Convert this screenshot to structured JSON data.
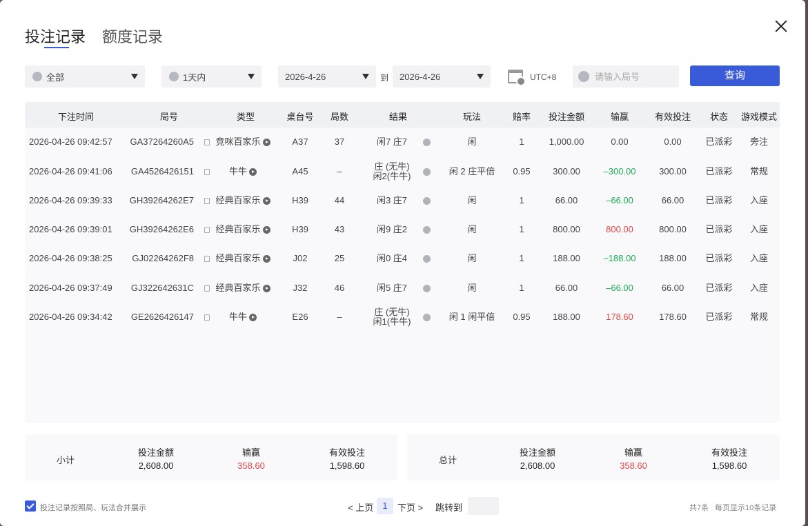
{
  "tabs": [
    {
      "label": "投注记录",
      "active": true
    },
    {
      "label": "额度记录",
      "active": false
    }
  ],
  "filters": {
    "game": "全部",
    "period": "1天内",
    "date_from": "2026-4-26",
    "to_label": "到",
    "date_to": "2026-4-26",
    "timezone": "UTC+8",
    "round_placeholder": "请输入局号",
    "query_label": "查询"
  },
  "table": {
    "headers": [
      "下注时间",
      "局号",
      "类型",
      "桌台号",
      "局数",
      "结果",
      "玩法",
      "赔率",
      "投注金额",
      "输赢",
      "有效投注",
      "状态",
      "游戏模式"
    ],
    "rows": [
      {
        "time": "2026-04-26 09:42:57",
        "round": "GA37264260A5",
        "type": "竞咪百家乐",
        "table": "A37",
        "count": "37",
        "result1": "闲7 庄7",
        "result2": "",
        "play": "闲",
        "odds": "1",
        "bet": "1,000.00",
        "win": "0.00",
        "win_sign": "zero",
        "valid": "0.00",
        "status": "已派彩",
        "mode": "旁注"
      },
      {
        "time": "2026-04-26 09:41:06",
        "round": "GA4526426151",
        "type": "牛牛",
        "table": "A45",
        "count": "–",
        "result1": "庄 (无牛)",
        "result2": "闲2(牛牛)",
        "play": "闲 2 庄平倍",
        "odds": "0.95",
        "bet": "300.00",
        "win": "–300.00",
        "win_sign": "neg",
        "valid": "300.00",
        "status": "已派彩",
        "mode": "常规"
      },
      {
        "time": "2026-04-26 09:39:33",
        "round": "GH39264262E7",
        "type": "经典百家乐",
        "table": "H39",
        "count": "44",
        "result1": "闲3 庄7",
        "result2": "",
        "play": "闲",
        "odds": "1",
        "bet": "66.00",
        "win": "–66.00",
        "win_sign": "neg",
        "valid": "66.00",
        "status": "已派彩",
        "mode": "入座"
      },
      {
        "time": "2026-04-26 09:39:01",
        "round": "GH39264262E6",
        "type": "经典百家乐",
        "table": "H39",
        "count": "43",
        "result1": "闲9 庄2",
        "result2": "",
        "play": "闲",
        "odds": "1",
        "bet": "800.00",
        "win": "800.00",
        "win_sign": "pos",
        "valid": "800.00",
        "status": "已派彩",
        "mode": "入座"
      },
      {
        "time": "2026-04-26 09:38:25",
        "round": "GJ02264262F8",
        "type": "经典百家乐",
        "table": "J02",
        "count": "25",
        "result1": "闲0 庄4",
        "result2": "",
        "play": "闲",
        "odds": "1",
        "bet": "188.00",
        "win": "–188.00",
        "win_sign": "neg",
        "valid": "188.00",
        "status": "已派彩",
        "mode": "入座"
      },
      {
        "time": "2026-04-26 09:37:49",
        "round": "GJ322642631C",
        "type": "经典百家乐",
        "table": "J32",
        "count": "46",
        "result1": "闲5 庄7",
        "result2": "",
        "play": "闲",
        "odds": "1",
        "bet": "66.00",
        "win": "–66.00",
        "win_sign": "neg",
        "valid": "66.00",
        "status": "已派彩",
        "mode": "入座"
      },
      {
        "time": "2026-04-26 09:34:42",
        "round": "GE2626426147",
        "type": "牛牛",
        "table": "E26",
        "count": "–",
        "result1": "庄 (无牛)",
        "result2": "闲1(牛牛)",
        "play": "闲 1 闲平倍",
        "odds": "0.95",
        "bet": "188.00",
        "win": "178.60",
        "win_sign": "pos",
        "valid": "178.60",
        "status": "已派彩",
        "mode": "常规"
      }
    ]
  },
  "subtotal": {
    "label": "小计",
    "bet_label": "投注金额",
    "bet": "2,608.00",
    "win_label": "输赢",
    "win": "358.60",
    "valid_label": "有效投注",
    "valid": "1,598.60"
  },
  "total": {
    "label": "总计",
    "bet_label": "投注金额",
    "bet": "2,608.00",
    "win_label": "输赢",
    "win": "358.60",
    "valid_label": "有效投注",
    "valid": "1,598.60"
  },
  "footer": {
    "merge_label": "投注记录按照局、玩法合并展示",
    "prev": "< 上页",
    "page": "1",
    "next": "下页 >",
    "jump_label": "跳转到",
    "count": "共7条",
    "per_page": "每页显示10条记录"
  },
  "colors": {
    "accent": "#3a5bd9",
    "win": "#e64545",
    "loss": "#1aae55"
  }
}
